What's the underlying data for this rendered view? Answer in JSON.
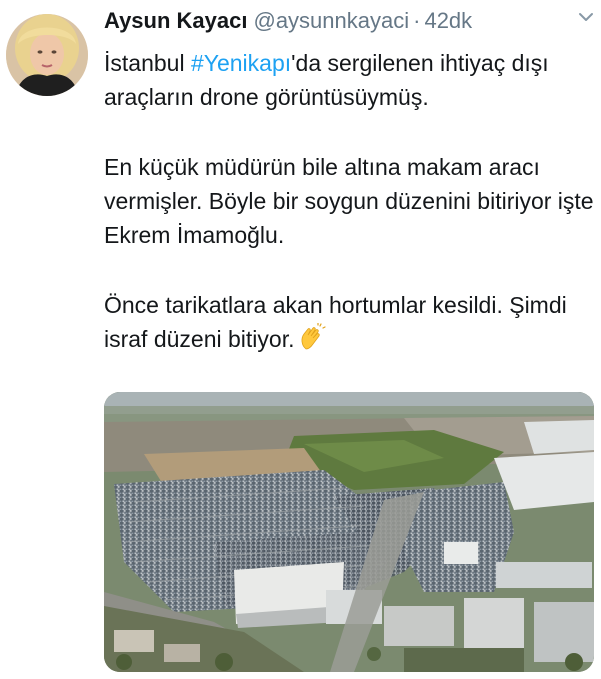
{
  "tweet": {
    "author_name": "Aysun Kayacı",
    "author_handle": "@aysunnkayaci",
    "separator": "·",
    "timestamp": "42dk",
    "paragraphs": [
      {
        "line_before": "İstanbul ",
        "hashtag": "#Yenikapı",
        "line_after": "'da sergilenen ihtiyaç dışı araçların drone görüntüsüymüş."
      },
      {
        "text": "En küçük müdürün bile altına makam aracı vermişler. Böyle bir soygun düzenini bitiriyor işte Ekrem İmamoğlu."
      },
      {
        "text": "Önce tarikatlara akan hortumlar kesildi. Şimdi israf düzeni bitiyor."
      }
    ],
    "emoji": "clapping-hands",
    "colors": {
      "name": "#14171a",
      "secondary": "#657786",
      "hashtag": "#1da1f2"
    },
    "icons": {
      "caret": "chevron-down-icon",
      "emoji": "clapping-hands-icon"
    }
  }
}
